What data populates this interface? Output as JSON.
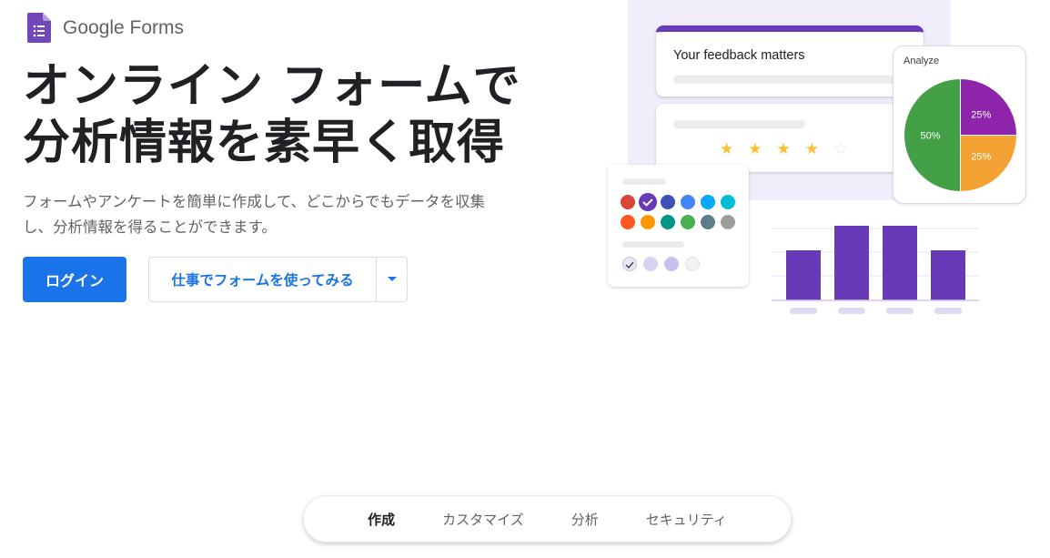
{
  "brand": {
    "name": "Google Forms",
    "icon": "google-forms-icon"
  },
  "hero": {
    "title_line1": "オンライン フォームで",
    "title_line2": "分析情報を素早く取得",
    "subtitle_line1": "フォームやアンケートを簡単に作成して、どこからでもデータを収集",
    "subtitle_line2": "し、分析情報を得ることができます。"
  },
  "actions": {
    "login_label": "ログイン",
    "try_work_label": "仕事でフォームを使ってみる",
    "dropdown_icon": "caret-down-icon"
  },
  "illustration": {
    "feedback_title": "Your feedback matters",
    "analyze_label": "Analyze",
    "rating": {
      "filled": 4,
      "total": 5
    },
    "pie": [
      {
        "label": "50%",
        "value": 50,
        "color": "#43a047"
      },
      {
        "label": "25%",
        "value": 25,
        "color": "#8e24aa"
      },
      {
        "label": "25%",
        "value": 25,
        "color": "#f4a234"
      }
    ],
    "bars": [
      55,
      82,
      82,
      55
    ],
    "bar_color": "#673ab7",
    "swatches_row1": [
      "#db4437",
      "#673ab7",
      "#3f51b5",
      "#4285f4",
      "#03a9f4",
      "#00bcd4"
    ],
    "swatches_row2": [
      "#ff5722",
      "#ff9800",
      "#009688",
      "#4caf50",
      "#607d8b",
      "#9e9e9e"
    ]
  },
  "nav": {
    "items": [
      {
        "label": "作成",
        "active": true
      },
      {
        "label": "カスタマイズ",
        "active": false
      },
      {
        "label": "分析",
        "active": false
      },
      {
        "label": "セキュリティ",
        "active": false
      }
    ]
  },
  "colors": {
    "primary": "#1a73e8",
    "accent": "#673ab7"
  }
}
